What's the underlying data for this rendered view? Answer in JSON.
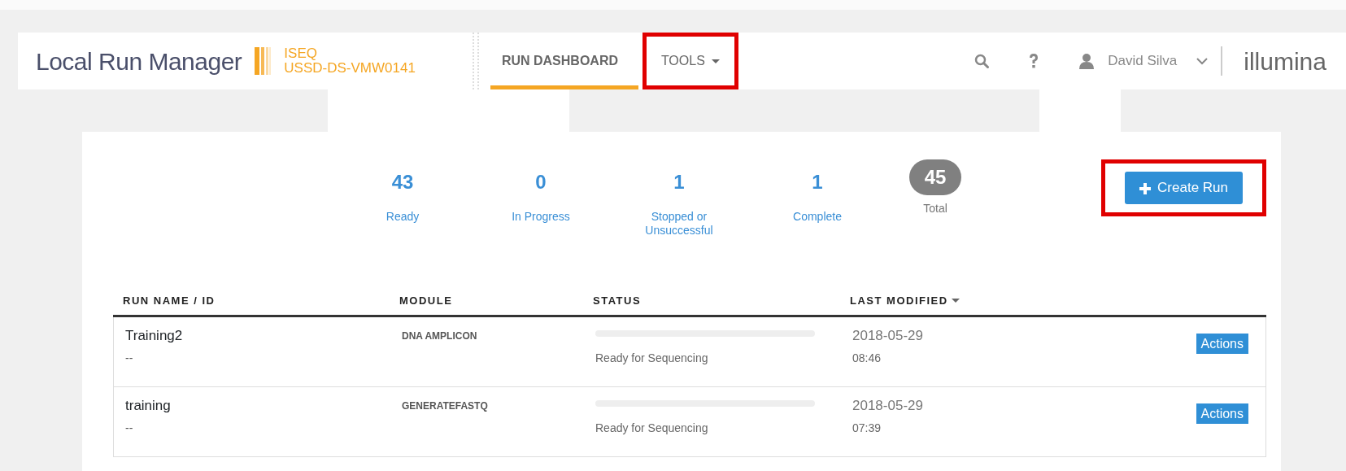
{
  "header": {
    "app_title": "Local Run Manager",
    "instrument": "ISEQ",
    "host": "USSD-DS-VMW0141",
    "nav": [
      {
        "label": "RUN DASHBOARD",
        "selected": true,
        "dropdown": false,
        "highlighted": false
      },
      {
        "label": "TOOLS",
        "selected": false,
        "dropdown": true,
        "highlighted": true
      }
    ],
    "user": "David Silva",
    "brand": "illumina"
  },
  "stats": [
    {
      "value": "43",
      "label": "Ready",
      "kind": "count"
    },
    {
      "value": "0",
      "label": "In Progress",
      "kind": "count"
    },
    {
      "value": "1",
      "label": "Stopped or Unsuccessful",
      "kind": "count"
    },
    {
      "value": "1",
      "label": "Complete",
      "kind": "count"
    },
    {
      "value": "45",
      "label": "Total",
      "kind": "total"
    }
  ],
  "create_button": {
    "label": "Create Run",
    "highlighted": true
  },
  "table": {
    "columns": [
      {
        "label": "RUN NAME / ID",
        "sorted": false
      },
      {
        "label": "MODULE",
        "sorted": false
      },
      {
        "label": "STATUS",
        "sorted": false
      },
      {
        "label": "LAST MODIFIED",
        "sorted": true
      }
    ],
    "rows": [
      {
        "name": "Training2",
        "id": "--",
        "module": "DNA AMPLICON",
        "level": 0,
        "status": "Ready for Sequencing",
        "date": "2018-05-29",
        "time": "08:46",
        "action": "Actions"
      },
      {
        "name": "training",
        "id": "--",
        "module": "GENERATEFASTQ",
        "level": 0,
        "status": "Ready for Sequencing",
        "date": "2018-05-29",
        "time": "07:39",
        "action": "Actions"
      }
    ]
  }
}
